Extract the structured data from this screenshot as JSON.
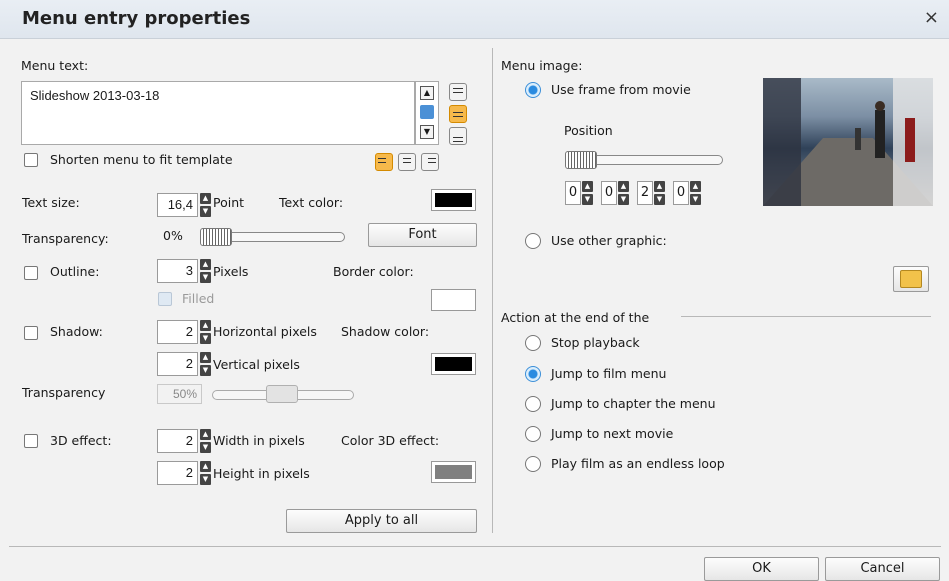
{
  "dialog": {
    "title": "Menu entry properties",
    "close": "×"
  },
  "left": {
    "menu_text_label": "Menu text:",
    "menu_text_value": "Slideshow 2013-03-18",
    "shorten_label": "Shorten menu to fit template",
    "text_size_label": "Text size:",
    "text_size_value": "16,4",
    "text_size_unit": "Point",
    "text_color_label": "Text color:",
    "text_color": "#000000",
    "transparency_label": "Transparency:",
    "transparency_value": "0%",
    "font_button": "Font",
    "outline_label": "Outline:",
    "outline_value": "3",
    "outline_unit": "Pixels",
    "border_color_label": "Border color:",
    "border_color": "#ffffff",
    "filled_label": "Filled",
    "shadow_label": "Shadow:",
    "shadow_h_value": "2",
    "shadow_h_unit": "Horizontal pixels",
    "shadow_color_label": "Shadow color:",
    "shadow_color": "#000000",
    "shadow_v_value": "2",
    "shadow_v_unit": "Vertical pixels",
    "transparency2_label": "Transparency",
    "transparency2_value": "50%",
    "effect3d_label": "3D effect:",
    "width_value": "2",
    "width_unit": "Width in pixels",
    "color3d_label": "Color 3D effect:",
    "color3d": "#808080",
    "height_value": "2",
    "height_unit": "Height in pixels",
    "apply_all": "Apply to all"
  },
  "right": {
    "menu_image_label": "Menu image:",
    "use_frame_label": "Use frame from movie",
    "position_label": "Position",
    "time_values": [
      "0",
      "0",
      "2",
      "0"
    ],
    "use_other_label": "Use other graphic:",
    "action_label": "Action at the end of the",
    "actions": [
      {
        "label": "Stop playback",
        "selected": false
      },
      {
        "label": "Jump to film menu",
        "selected": true
      },
      {
        "label": "Jump to chapter the menu",
        "selected": false
      },
      {
        "label": "Jump to next movie",
        "selected": false
      },
      {
        "label": "Play film as an endless loop",
        "selected": false
      }
    ]
  },
  "footer": {
    "ok": "OK",
    "cancel": "Cancel"
  }
}
